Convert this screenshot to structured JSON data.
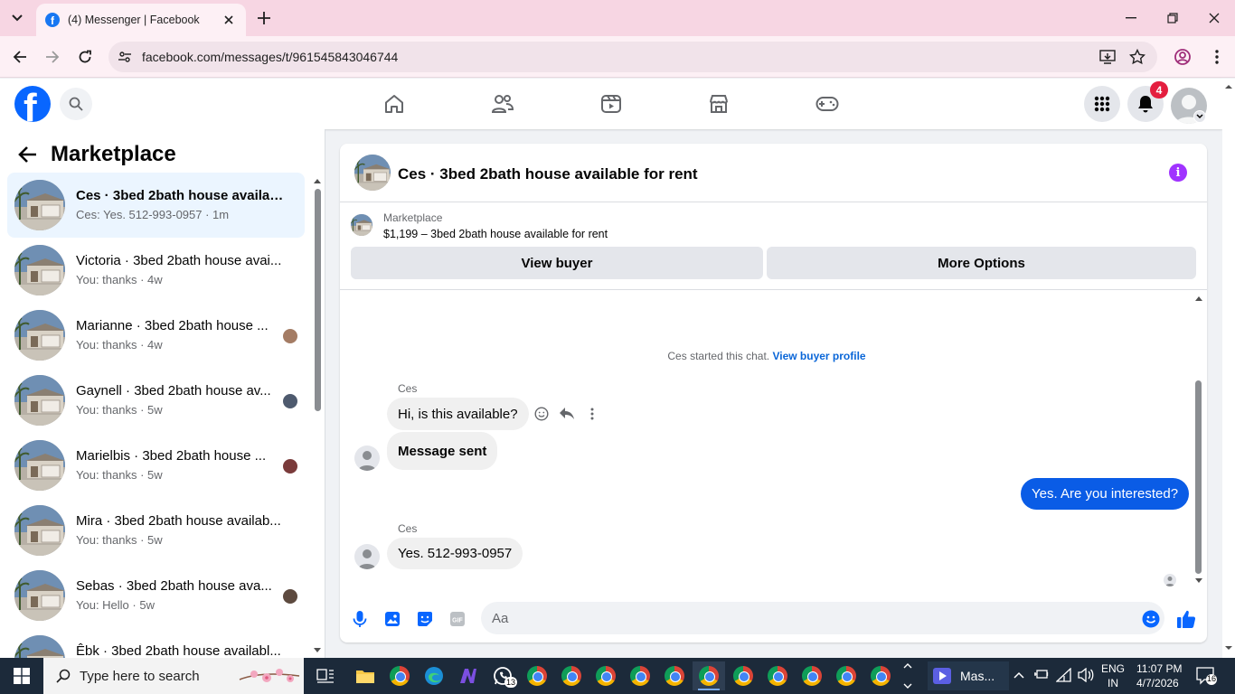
{
  "browser": {
    "tab_title": "(4) Messenger | Facebook",
    "url": "facebook.com/messages/t/961545843046744"
  },
  "header": {
    "notification_count": "4"
  },
  "sidebar": {
    "title": "Marketplace",
    "conversations": [
      {
        "name": "Ces · 3bed 2bath house availabl...",
        "sub": "Ces: Yes. 512-993-0957 · 1m",
        "active": true,
        "bold": true
      },
      {
        "name": "Victoria · 3bed 2bath house avai...",
        "sub": "You: thanks · 4w"
      },
      {
        "name": "Marianne · 3bed 2bath house ...",
        "sub": "You: thanks · 4w"
      },
      {
        "name": "Gaynell · 3bed 2bath house av...",
        "sub": "You: thanks · 5w"
      },
      {
        "name": "Marielbis · 3bed 2bath house ...",
        "sub": "You: thanks · 5w"
      },
      {
        "name": "Mira · 3bed 2bath house availab...",
        "sub": "You: thanks · 5w"
      },
      {
        "name": "Sebas · 3bed 2bath house ava...",
        "sub": "You: Hello · 5w"
      },
      {
        "name": "Êbk · 3bed 2bath house availabl...",
        "sub": ""
      }
    ]
  },
  "chat": {
    "title": "Ces · 3bed 2bath house available for rent",
    "listing_label": "Marketplace",
    "listing_title": "$1,199 – 3bed 2bath house available for rent",
    "view_buyer": "View buyer",
    "more_options": "More Options",
    "system_text": "Ces started this chat.",
    "system_link": "View buyer profile",
    "sender_1": "Ces",
    "msg_1": "Hi, is this available?",
    "msg_2": "Message sent",
    "msg_3": "Yes. Are you interested?",
    "sender_2": "Ces",
    "msg_4": "Yes. 512-993-0957",
    "composer_placeholder": "Aa"
  },
  "taskbar": {
    "search_placeholder": "Type here to search",
    "whatsapp_badge": "13",
    "active_window": "Mas...",
    "lang_1": "ENG",
    "lang_2": "IN",
    "time": "11:07 PM",
    "date": "4/7/2026",
    "notif_count": "16"
  },
  "colors": {
    "fb_blue": "#0866ff",
    "my_bubble": "#0a5ce6",
    "active_convo": "#ebf5ff",
    "badge_red": "#e41e3f",
    "info_purple": "#a033ff"
  }
}
